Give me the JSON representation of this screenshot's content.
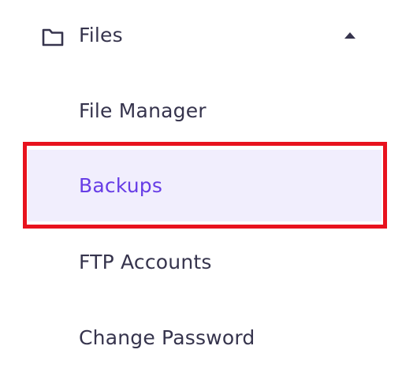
{
  "files_section": {
    "title": "Files",
    "icon": "folder-icon",
    "toggle_icon": "caret-up-icon",
    "expanded": true
  },
  "items": [
    {
      "label": "File Manager",
      "active": false
    },
    {
      "label": "Backups",
      "active": true
    },
    {
      "label": "FTP Accounts",
      "active": false
    },
    {
      "label": "Change Password",
      "active": false
    }
  ],
  "colors": {
    "text": "#36344d",
    "active_text": "#673de6",
    "active_background": "#f1eefd",
    "highlight_border": "#e8121e"
  }
}
